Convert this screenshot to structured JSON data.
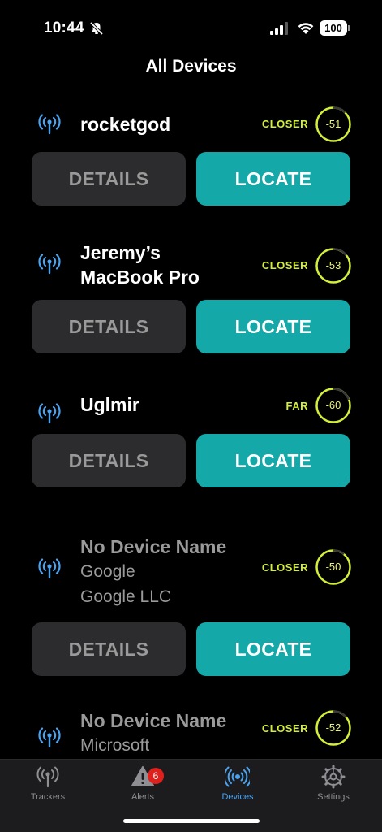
{
  "status_bar": {
    "time": "10:44",
    "battery": "100"
  },
  "header": {
    "title": "All Devices"
  },
  "buttons": {
    "details": "DETAILS",
    "locate": "LOCATE"
  },
  "devices": [
    {
      "name": "rocketgod",
      "sub1": "",
      "sub2": "",
      "proximity": "CLOSER",
      "rssi": "-51"
    },
    {
      "name": "Jeremy’s",
      "name2": "MacBook Pro",
      "sub1": "",
      "sub2": "",
      "proximity": "CLOSER",
      "rssi": "-53"
    },
    {
      "name": "Uglmir",
      "sub1": "",
      "sub2": "",
      "proximity": "FAR",
      "rssi": "-60"
    },
    {
      "name": "No Device Name",
      "sub1": "Google",
      "sub2": "Google LLC",
      "proximity": "CLOSER",
      "rssi": "-50"
    },
    {
      "name": "No Device Name",
      "sub1": "Microsoft",
      "sub2": "",
      "proximity": "CLOSER",
      "rssi": "-52"
    }
  ],
  "tabs": [
    {
      "label": "Trackers"
    },
    {
      "label": "Alerts",
      "badge": "6"
    },
    {
      "label": "Devices"
    },
    {
      "label": "Settings"
    }
  ],
  "colors": {
    "accent_teal": "#14a8a8",
    "proximity_yellow": "#d4ee3a",
    "active_tab_blue": "#4ba3f0"
  },
  "icons": {
    "device": "antenna-icon",
    "trackers": "antenna-icon",
    "alerts": "warning-icon",
    "devices": "broadcast-icon",
    "settings": "gear-icon"
  }
}
